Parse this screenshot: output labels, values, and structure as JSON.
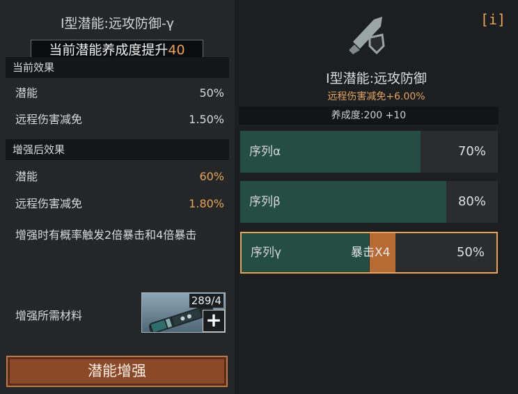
{
  "left": {
    "title": "I型潜能:远攻防御-γ",
    "boost_banner": {
      "prefix": "当前潜能养成度提升",
      "value": "40"
    },
    "current_effects": {
      "header": "当前效果",
      "rows": [
        {
          "label": "潜能",
          "value": "50%"
        },
        {
          "label": "远程伤害减免",
          "value": "1.50%"
        }
      ]
    },
    "enhanced_effects": {
      "header": "增强后效果",
      "rows": [
        {
          "label": "潜能",
          "value": "60%"
        },
        {
          "label": "远程伤害减免",
          "value": "1.80%"
        }
      ]
    },
    "note": "增强时有概率触发2倍暴击和4倍暴击",
    "materials": {
      "label": "增强所需材料",
      "count": "289/4",
      "plus": "+"
    },
    "enhance_button": "潜能增强"
  },
  "right": {
    "info_button": "[i]",
    "emblem_icon": "bullet-shield-icon",
    "title": "I型潜能:远攻防御",
    "subtitle": "远程伤害减免+6.00%",
    "level": "养成度:200  +10",
    "sequences": [
      {
        "label": "序列α",
        "percent": "70%",
        "fill": 0.7
      },
      {
        "label": "序列β",
        "percent": "80%",
        "fill": 0.8
      },
      {
        "label": "序列γ",
        "percent": "50%",
        "fill": 0.5,
        "crit": "暴击X4",
        "selected": true
      }
    ]
  },
  "colors": {
    "accent_orange": "#e7a45a",
    "fill_green": "#244d43",
    "button_bg": "#8a4a2a"
  }
}
